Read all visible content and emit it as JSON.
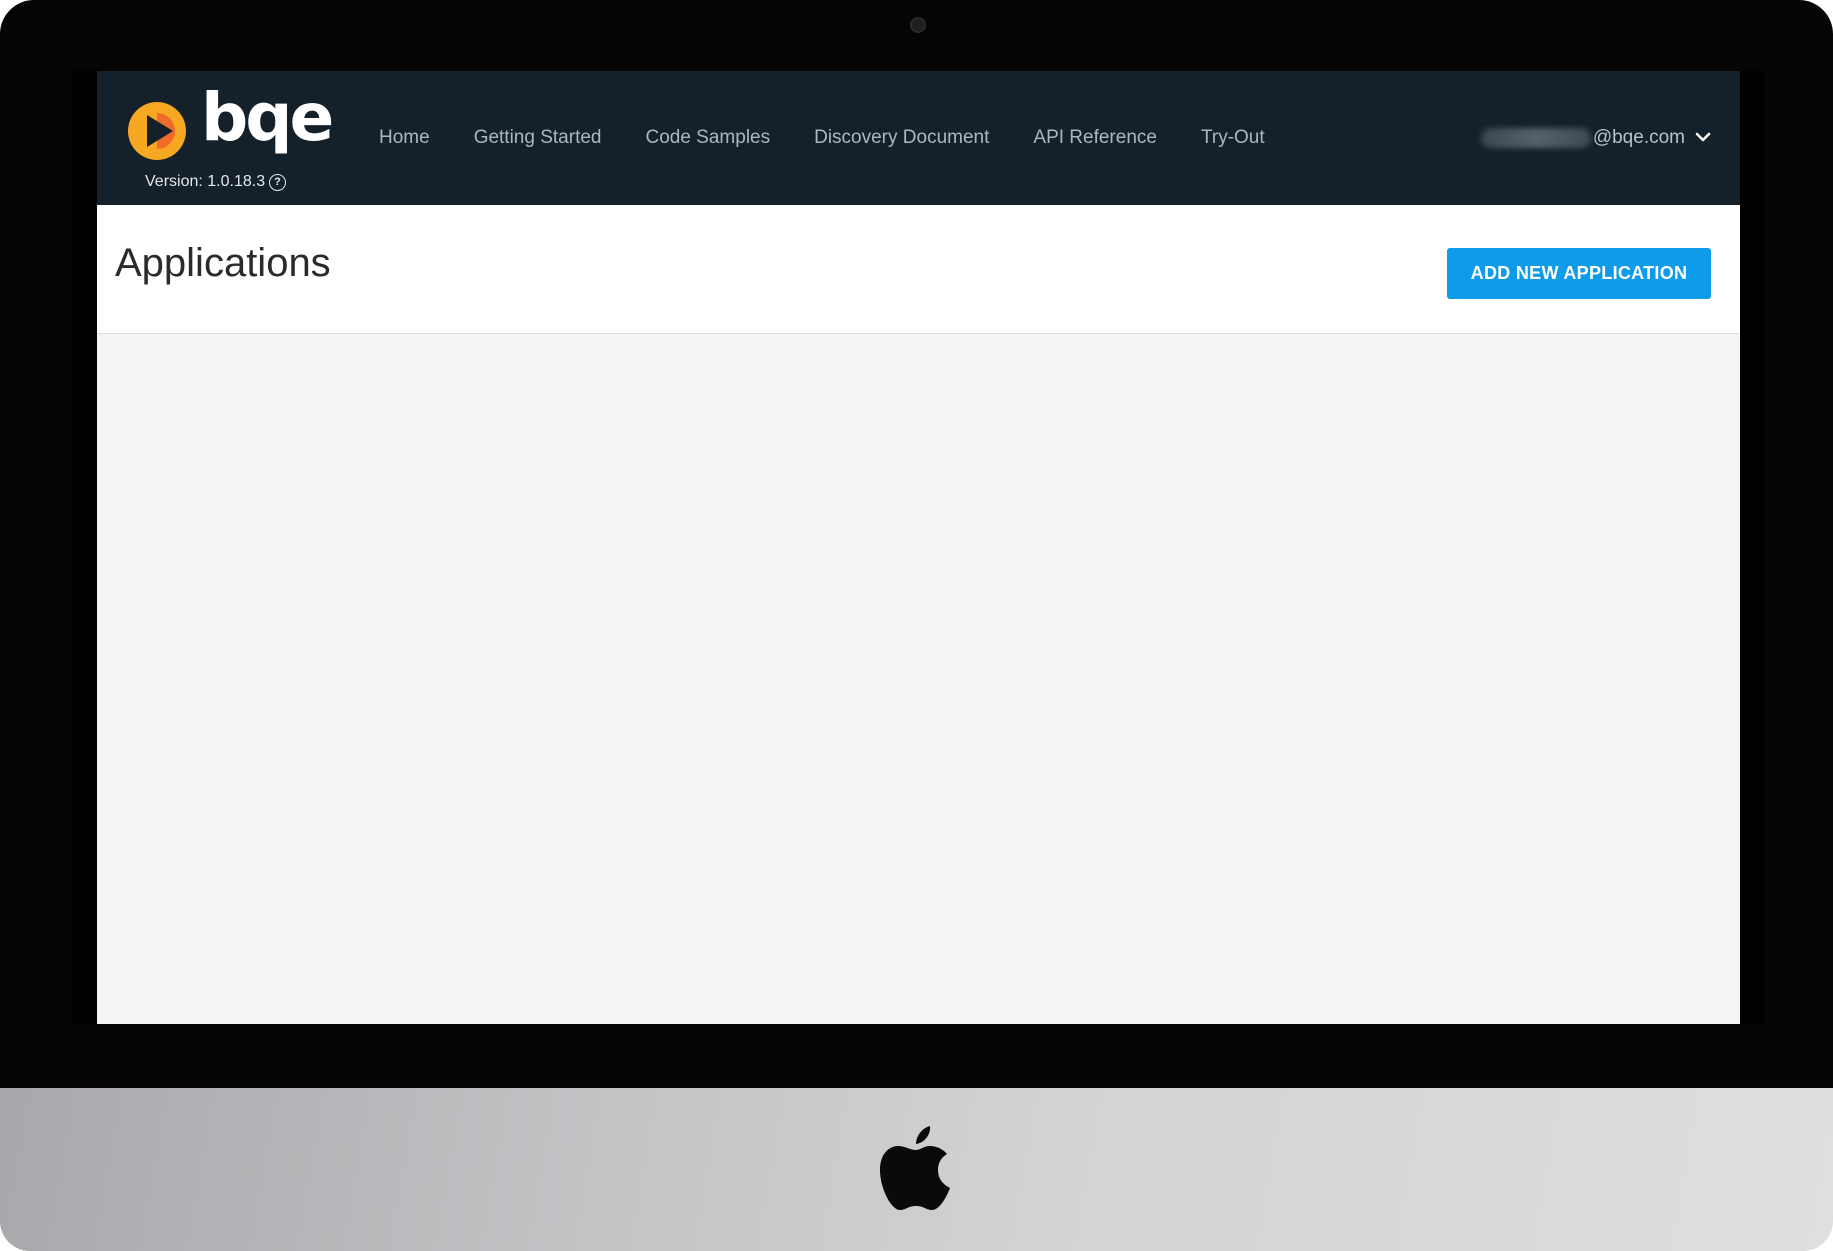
{
  "brand": {
    "name": "bqe",
    "version": "Version: 1.0.18.3"
  },
  "nav": {
    "items": [
      {
        "label": "Home"
      },
      {
        "label": "Getting Started"
      },
      {
        "label": "Code Samples"
      },
      {
        "label": "Discovery Document"
      },
      {
        "label": "API Reference"
      },
      {
        "label": "Try-Out"
      }
    ]
  },
  "user": {
    "email": "@bqe.com"
  },
  "page": {
    "title": "Applications",
    "add_button_label": "ADD NEW APPLICATION"
  },
  "icons": {
    "help": "help-circle-icon",
    "user_menu": "chevron-down-icon",
    "hardware": "apple-logo-icon"
  },
  "colors": {
    "topbar": "#14202a",
    "accent": "#0e9bea",
    "logo_orange": "#f7a823"
  }
}
